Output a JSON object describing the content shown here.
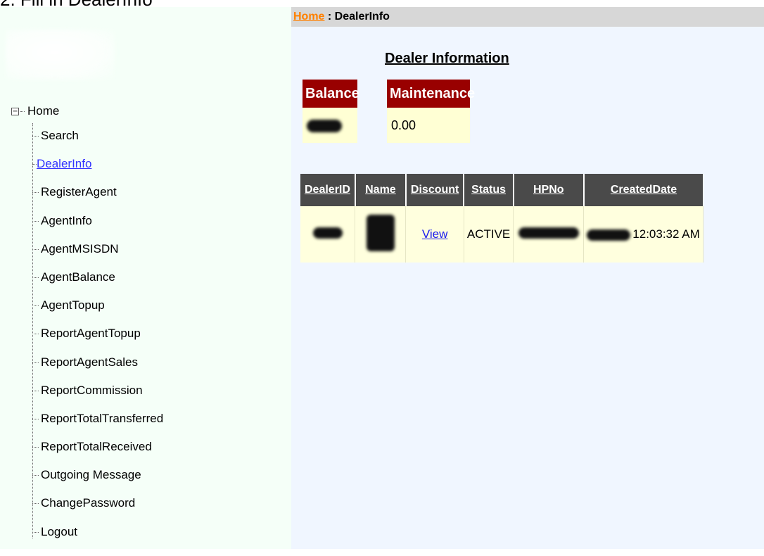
{
  "window": {
    "title_fragment": "2. Fill in  DealerInfo"
  },
  "breadcrumb": {
    "home": "Home",
    "separator": " : ",
    "current": "DealerInfo"
  },
  "sidebar": {
    "root": {
      "toggle": "−",
      "label": "Home"
    },
    "items": [
      {
        "label": "Search",
        "active": false
      },
      {
        "label": "DealerInfo",
        "active": true
      },
      {
        "label": "RegisterAgent",
        "active": false
      },
      {
        "label": "AgentInfo",
        "active": false
      },
      {
        "label": "AgentMSISDN",
        "active": false
      },
      {
        "label": "AgentBalance",
        "active": false
      },
      {
        "label": "AgentTopup",
        "active": false
      },
      {
        "label": "ReportAgentTopup",
        "active": false
      },
      {
        "label": "ReportAgentSales",
        "active": false
      },
      {
        "label": "ReportCommission",
        "active": false
      },
      {
        "label": "ReportTotalTransferred",
        "active": false
      },
      {
        "label": "ReportTotalReceived",
        "active": false
      },
      {
        "label": "Outgoing Message",
        "active": false
      },
      {
        "label": "ChangePassword",
        "active": false
      },
      {
        "label": "Logout",
        "active": false
      }
    ]
  },
  "main": {
    "title": "Dealer Information",
    "balance": {
      "header": "Balance",
      "value_redacted": true
    },
    "maintenance": {
      "header": "Maintenance",
      "value": "0.00"
    },
    "dealer_table": {
      "headers": [
        "DealerID",
        "Name",
        "Discount",
        "Status",
        "HPNo",
        "CreatedDate"
      ],
      "rows": [
        {
          "dealer_id_redacted": true,
          "name_redacted": true,
          "discount_link": "View",
          "status": "ACTIVE",
          "hpno_redacted": true,
          "created_date_visible": "12:03:32 AM"
        }
      ]
    }
  },
  "colors": {
    "sidebar_bg": "#f5fff8",
    "main_bg": "#f0f6ff",
    "breadcrumb_bg": "#d7d7d7",
    "breadcrumb_link": "#ff8000",
    "mini_header": "#990000",
    "cell_bg": "#ffffd4",
    "table_header": "#4a4a4a",
    "link": "#3333ff"
  }
}
